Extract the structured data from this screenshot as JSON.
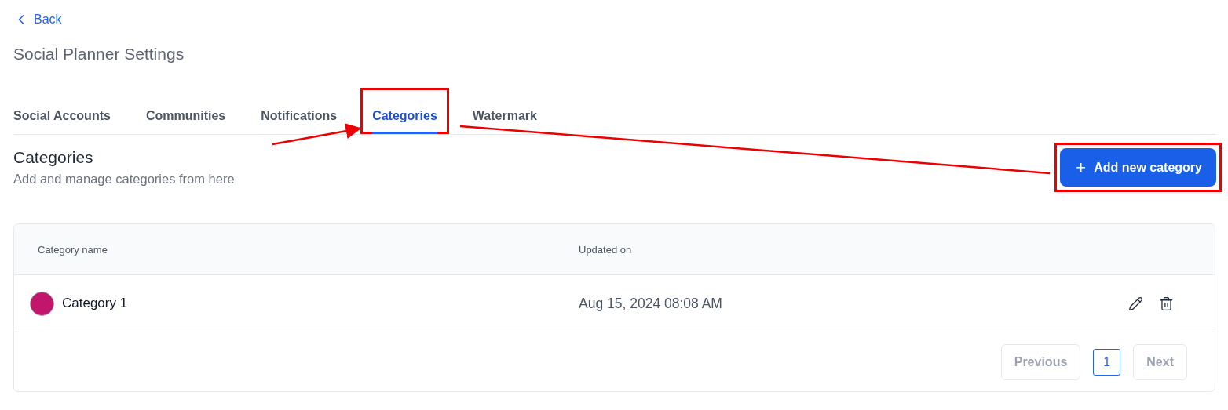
{
  "back": {
    "label": "Back"
  },
  "title": "Social Planner Settings",
  "tabs": [
    {
      "label": "Social Accounts",
      "selected": false,
      "highlighted": false
    },
    {
      "label": "Communities",
      "selected": false,
      "highlighted": false
    },
    {
      "label": "Notifications",
      "selected": false,
      "highlighted": false
    },
    {
      "label": "Categories",
      "selected": true,
      "highlighted": true
    },
    {
      "label": "Watermark",
      "selected": false,
      "highlighted": false
    }
  ],
  "section": {
    "heading": "Categories",
    "subtitle": "Add and manage categories from here"
  },
  "add_button": {
    "icon": "+",
    "label": "Add new category",
    "highlighted": true
  },
  "table": {
    "columns": [
      "Category name",
      "Updated on"
    ],
    "rows": [
      {
        "name": "Category 1",
        "color": "#c2166d",
        "updated": "Aug 15, 2024 08:08 AM"
      }
    ]
  },
  "pagination": {
    "previous": {
      "label": "Previous",
      "disabled": true
    },
    "pages": [
      {
        "label": "1",
        "selected": true
      }
    ],
    "next": {
      "label": "Next",
      "disabled": true
    }
  }
}
